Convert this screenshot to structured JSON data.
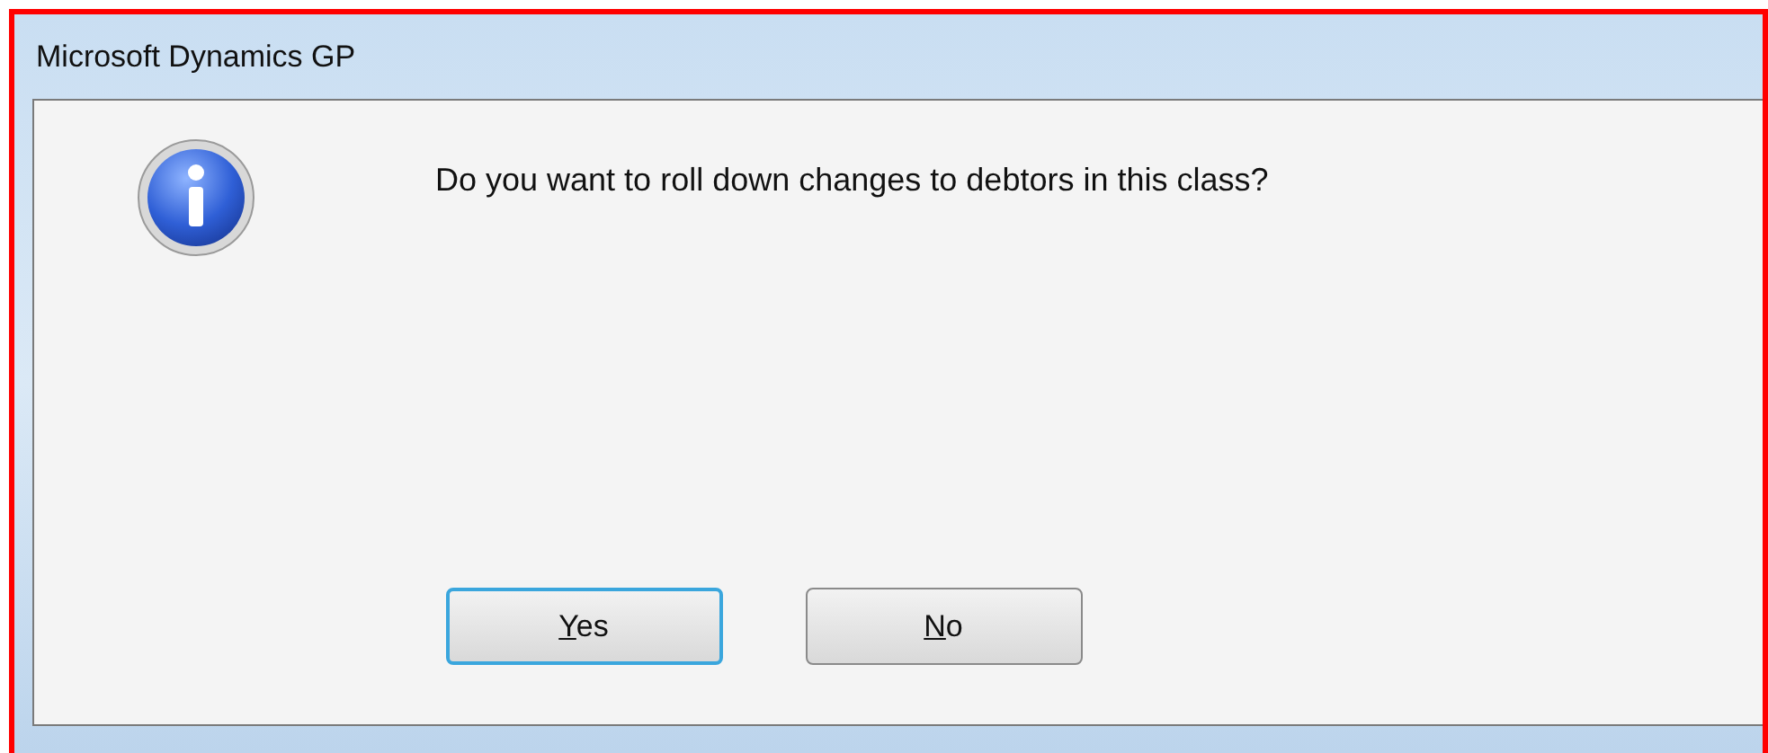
{
  "window": {
    "title": "Microsoft Dynamics GP"
  },
  "message": {
    "text": "Do you want to roll down changes to debtors in this class?"
  },
  "buttons": [
    {
      "label": "Yes",
      "default": true
    },
    {
      "label": "No",
      "default": false
    }
  ]
}
